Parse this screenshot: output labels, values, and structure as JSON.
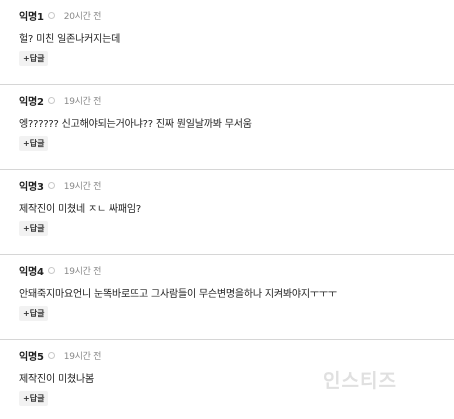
{
  "comments": [
    {
      "nickname": "익명1",
      "time": "20시간 전",
      "text": "헐? 미친 일존나커지는데",
      "reply_label": "+답글"
    },
    {
      "nickname": "익명2",
      "time": "19시간 전",
      "text": "엥?????? 신고해야되는거아냐?? 진짜 뭔일날까봐 무서움",
      "reply_label": "+답글"
    },
    {
      "nickname": "익명3",
      "time": "19시간 전",
      "text": "제작진이 미쳤네 ㅈㄴ 싸패임?",
      "reply_label": "+답글"
    },
    {
      "nickname": "익명4",
      "time": "19시간 전",
      "text": "안돼죽지마요언니 눈똑바로뜨고 그사람들이 무슨변명을하나 지켜봐야지ㅜㅜㅜ",
      "reply_label": "+답글"
    },
    {
      "nickname": "익명5",
      "time": "19시간 전",
      "text": "제작진이 미쳤나봄",
      "reply_label": "+답글"
    }
  ],
  "watermark": "인스티즈"
}
